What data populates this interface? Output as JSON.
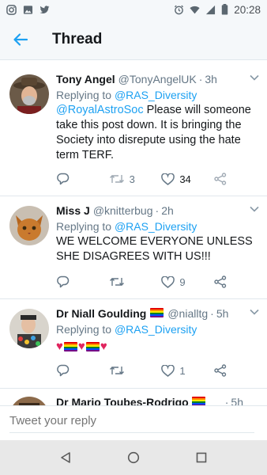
{
  "status_bar": {
    "time": "20:28",
    "left_icons": [
      "instagram-icon",
      "gallery-icon",
      "twitter-icon"
    ],
    "right_icons": [
      "alarm-icon",
      "wifi-icon",
      "signal-icon",
      "battery-icon"
    ]
  },
  "header": {
    "title": "Thread",
    "back_icon": "arrow-left-icon"
  },
  "colors": {
    "accent": "#1da1f2",
    "muted": "#657786",
    "text": "#14171a"
  },
  "tweets": [
    {
      "name": "Tony Angel",
      "handle": "@TonyAngelUK",
      "dot": "·",
      "time": "3h",
      "replying_prefix": "Replying to",
      "replying_to": "@RAS_Diversity",
      "mention": "@RoyalAstroSoc",
      "text": " Please will someone take this post down. It is bringing the Society into disrepute using the hate term TERF.",
      "retweets": "3",
      "likes": "34"
    },
    {
      "name": "Miss J",
      "handle": "@knitterbug",
      "dot": "·",
      "time": "2h",
      "replying_prefix": "Replying to",
      "replying_to": "@RAS_Diversity",
      "text": "WE WELCOME EVERYONE UNLESS SHE DISAGREES WITH US!!!",
      "retweets": "",
      "likes": "9"
    },
    {
      "name": "Dr Niall Goulding",
      "handle": "@nialltg",
      "dot": "·",
      "time": "5h",
      "replying_prefix": "Replying to",
      "replying_to": "@RAS_Diversity",
      "text_emoji": "❤️🏳️‍🌈❤️🏳️‍🌈❤️",
      "retweets": "",
      "likes": "1"
    },
    {
      "name": "Dr Mario Toubes-Rodrigo",
      "dot": "·",
      "time": "5h"
    }
  ],
  "compose": {
    "placeholder": "Tweet your reply"
  },
  "nav": {
    "icons": [
      "back-triangle-icon",
      "home-circle-icon",
      "recents-square-icon"
    ]
  }
}
